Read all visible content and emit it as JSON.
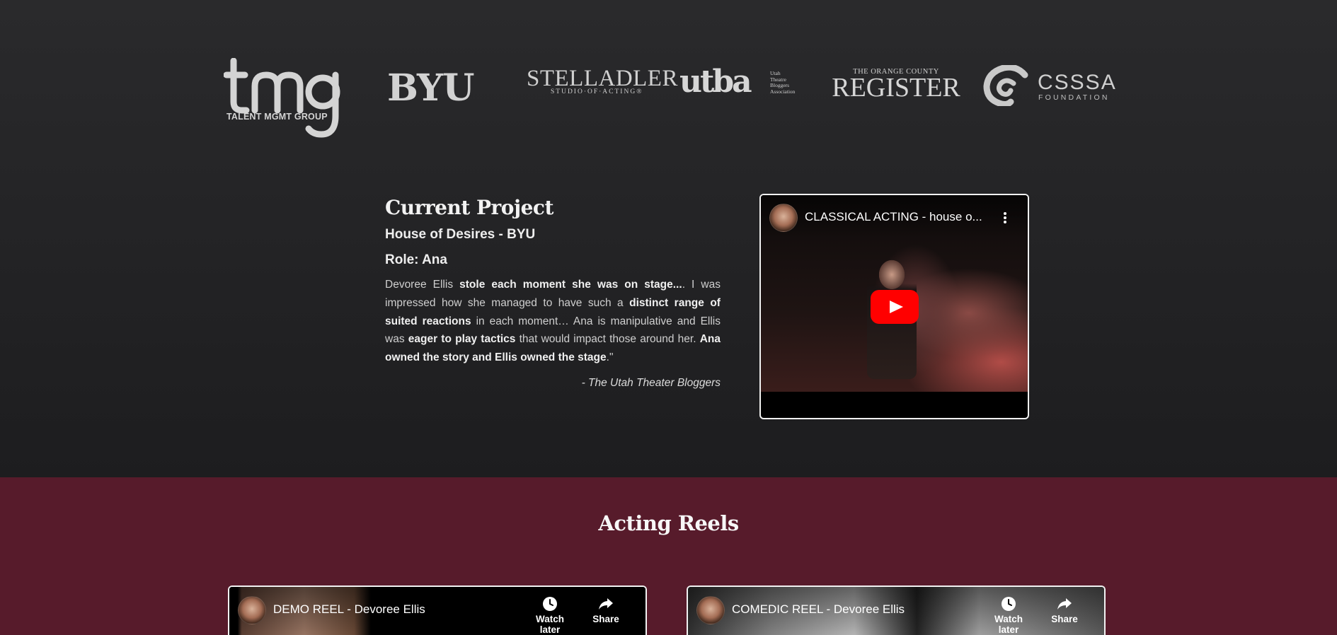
{
  "logos": {
    "tmg": {
      "mark": "tmg",
      "subtitle": "TALENT MGMT GROUP"
    },
    "byu": "BYU",
    "stella_adler": {
      "main": "STELLADLER",
      "subtitle": "STUDIO·OF·ACTING®"
    },
    "utba": {
      "main": "utba",
      "subtitle_lines": [
        "Utah",
        "Theatre",
        "Bloggers",
        "Association"
      ]
    },
    "register": {
      "top_line": "THE ORANGE COUNTY",
      "main": "REGISTER"
    },
    "csssa": {
      "main": "CSSSA",
      "subtitle": "FOUNDATION"
    }
  },
  "current_project": {
    "heading": "Current Project",
    "title": "House of Desires - BYU",
    "role": "Role: Ana",
    "quote": {
      "p1": "Devoree Ellis ",
      "b1": "stole each moment she was on stage...",
      "p2": ". I was impressed how she managed to have such a ",
      "b2": "distinct range of suited reactions",
      "p3": " in each moment… Ana is manipulative and Ellis was ",
      "b3": "eager to play tactics",
      "p4": " that would impact those around her. ",
      "b4": "Ana owned the story and Ellis owned the stage",
      "p5": ".\""
    },
    "attribution": "- The Utah Theater Bloggers"
  },
  "featured_video": {
    "title": "CLASSICAL ACTING - house o...",
    "icons": [
      "channel-avatar",
      "kebab-menu-icon",
      "youtube-play-icon"
    ]
  },
  "reels": {
    "heading": "Acting Reels",
    "videos": [
      {
        "title": "DEMO REEL - Devoree Ellis",
        "watch_later": "Watch later",
        "share": "Share"
      },
      {
        "title": "COMEDIC REEL - Devoree Ellis",
        "watch_later": "Watch later",
        "share": "Share"
      }
    ]
  },
  "colors": {
    "top_background": "#252527",
    "reels_background": "#571b2b",
    "youtube_red": "#ff0000",
    "text_light": "#e8e8e8"
  }
}
